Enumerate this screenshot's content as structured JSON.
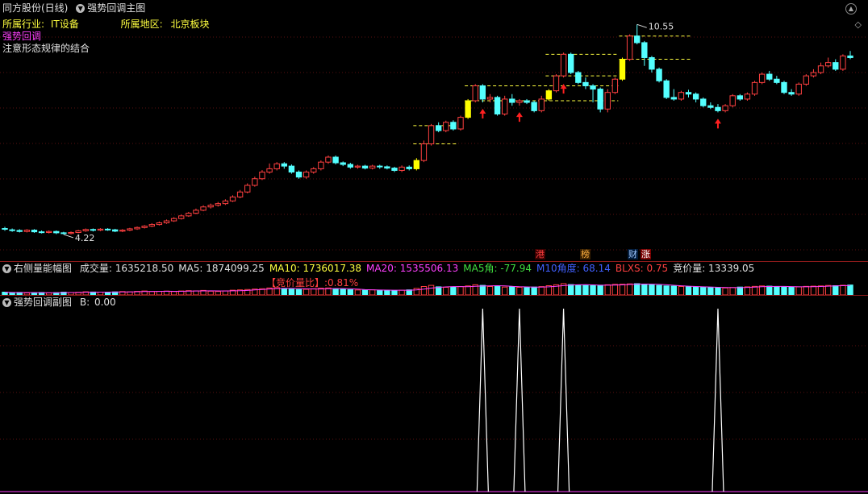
{
  "main": {
    "title": "同方股份(日线)",
    "indicator": "强势回调主图",
    "industry_label": "所属行业:",
    "industry_value": "IT设备",
    "region_label": "所属地区:",
    "region_value": "北京板块",
    "signal_name": "强势回调",
    "note": "注意形态规律的结合",
    "high_label": "10.55",
    "low_label": "4.22",
    "tags": [
      "港",
      "榜",
      "财",
      "涨"
    ]
  },
  "volume_panel": {
    "title": "右侧量能幅图",
    "items": [
      {
        "label": "成交量:",
        "value": "1635218.50",
        "color": "#e0e0e0"
      },
      {
        "label": "MA5:",
        "value": "1874099.25",
        "color": "#e0e0e0"
      },
      {
        "label": "MA10:",
        "value": "1736017.38",
        "color": "#ffff40"
      },
      {
        "label": "MA20:",
        "value": "1535506.13",
        "color": "#ff40ff"
      },
      {
        "label": "MA5角:",
        "value": "-77.94",
        "color": "#40e040"
      },
      {
        "label": "M10角度:",
        "value": "68.14",
        "color": "#4060ff"
      },
      {
        "label": "BLXS:",
        "value": "0.75",
        "color": "#ff4040"
      },
      {
        "label": "竞价量:",
        "value": "13339.05",
        "color": "#e0e0e0"
      }
    ],
    "bid_ratio_label": "【竞价量比】:0.81%"
  },
  "sub_panel": {
    "title": "强势回调副图",
    "b_label": "B:",
    "b_value": "0.00"
  },
  "chart_data": {
    "type": "candlestick",
    "ylim": [
      4.0,
      10.8
    ],
    "annotations": {
      "max": 10.55,
      "min": 4.22
    },
    "candles": [
      [
        4.4,
        4.38,
        4.45,
        4.33
      ],
      [
        4.36,
        4.34,
        4.4,
        4.3
      ],
      [
        4.34,
        4.31,
        4.38,
        4.28
      ],
      [
        4.31,
        4.35,
        4.38,
        4.28
      ],
      [
        4.35,
        4.3,
        4.38,
        4.27
      ],
      [
        4.3,
        4.28,
        4.34,
        4.25
      ],
      [
        4.28,
        4.31,
        4.34,
        4.25
      ],
      [
        4.31,
        4.27,
        4.34,
        4.23
      ],
      [
        4.27,
        4.25,
        4.3,
        4.22
      ],
      [
        4.25,
        4.28,
        4.31,
        4.22
      ],
      [
        4.28,
        4.33,
        4.36,
        4.26
      ],
      [
        4.33,
        4.37,
        4.4,
        4.3
      ],
      [
        4.37,
        4.35,
        4.4,
        4.31
      ],
      [
        4.35,
        4.38,
        4.41,
        4.32
      ],
      [
        4.38,
        4.36,
        4.41,
        4.33
      ],
      [
        4.36,
        4.32,
        4.39,
        4.29
      ],
      [
        4.32,
        4.35,
        4.38,
        4.29
      ],
      [
        4.35,
        4.39,
        4.42,
        4.32
      ],
      [
        4.39,
        4.43,
        4.46,
        4.36
      ],
      [
        4.43,
        4.47,
        4.5,
        4.4
      ],
      [
        4.47,
        4.52,
        4.56,
        4.44
      ],
      [
        4.52,
        4.57,
        4.61,
        4.49
      ],
      [
        4.57,
        4.63,
        4.67,
        4.54
      ],
      [
        4.63,
        4.7,
        4.74,
        4.6
      ],
      [
        4.7,
        4.78,
        4.82,
        4.67
      ],
      [
        4.78,
        4.86,
        4.9,
        4.75
      ],
      [
        4.86,
        4.95,
        5.0,
        4.83
      ],
      [
        4.95,
        5.05,
        5.1,
        4.92
      ],
      [
        5.05,
        5.1,
        5.15,
        5.0
      ],
      [
        5.1,
        5.15,
        5.2,
        5.06
      ],
      [
        5.15,
        5.23,
        5.28,
        5.11
      ],
      [
        5.23,
        5.35,
        5.4,
        5.2
      ],
      [
        5.35,
        5.5,
        5.56,
        5.31
      ],
      [
        5.5,
        5.7,
        5.76,
        5.46
      ],
      [
        5.7,
        5.9,
        5.96,
        5.66
      ],
      [
        5.9,
        6.1,
        6.16,
        5.86
      ],
      [
        6.1,
        6.2,
        6.36,
        6.05
      ],
      [
        6.2,
        6.35,
        6.4,
        6.15
      ],
      [
        6.35,
        6.28,
        6.4,
        6.2
      ],
      [
        6.28,
        6.1,
        6.33,
        6.05
      ],
      [
        6.1,
        5.95,
        6.15,
        5.9
      ],
      [
        5.95,
        6.1,
        6.15,
        5.9
      ],
      [
        6.1,
        6.2,
        6.25,
        6.05
      ],
      [
        6.2,
        6.4,
        6.45,
        6.15
      ],
      [
        6.4,
        6.55,
        6.6,
        6.35
      ],
      [
        6.55,
        6.38,
        6.6,
        6.33
      ],
      [
        6.38,
        6.33,
        6.42,
        6.28
      ],
      [
        6.33,
        6.25,
        6.38,
        6.2
      ],
      [
        6.25,
        6.28,
        6.32,
        6.2
      ],
      [
        6.28,
        6.22,
        6.32,
        6.18
      ],
      [
        6.22,
        6.28,
        6.32,
        6.18
      ],
      [
        6.28,
        6.26,
        6.32,
        6.2
      ],
      [
        6.26,
        6.22,
        6.3,
        6.18
      ],
      [
        6.22,
        6.15,
        6.26,
        6.1
      ],
      [
        6.15,
        6.25,
        6.3,
        6.1
      ],
      [
        6.25,
        6.2,
        6.3,
        6.15
      ],
      [
        6.2,
        6.45,
        6.52,
        6.15
      ],
      [
        6.45,
        6.95,
        7.05,
        6.4
      ],
      [
        6.95,
        7.5,
        7.55,
        6.9
      ],
      [
        7.5,
        7.35,
        7.6,
        7.3
      ],
      [
        7.35,
        7.6,
        7.65,
        7.3
      ],
      [
        7.6,
        7.4,
        7.66,
        7.35
      ],
      [
        7.4,
        7.75,
        7.8,
        7.35
      ],
      [
        7.75,
        8.25,
        8.3,
        7.7
      ],
      [
        8.25,
        8.7,
        8.75,
        8.2
      ],
      [
        8.7,
        8.3,
        8.75,
        8.2
      ],
      [
        8.3,
        8.35,
        8.45,
        8.2
      ],
      [
        8.35,
        7.85,
        8.4,
        7.8
      ],
      [
        7.85,
        8.3,
        8.4,
        7.8
      ],
      [
        8.3,
        8.2,
        8.45,
        8.1
      ],
      [
        8.2,
        8.25,
        8.3,
        8.1
      ],
      [
        8.25,
        8.2,
        8.3,
        8.15
      ],
      [
        8.2,
        7.95,
        8.25,
        7.9
      ],
      [
        7.95,
        8.3,
        8.4,
        7.9
      ],
      [
        8.3,
        8.55,
        8.6,
        8.25
      ],
      [
        8.55,
        9.0,
        9.05,
        8.5
      ],
      [
        9.0,
        9.65,
        9.7,
        8.95
      ],
      [
        9.65,
        9.1,
        9.7,
        9.05
      ],
      [
        9.1,
        8.8,
        9.15,
        8.75
      ],
      [
        8.8,
        8.7,
        8.95,
        8.6
      ],
      [
        8.7,
        8.6,
        8.75,
        8.2
      ],
      [
        8.6,
        8.0,
        8.65,
        7.9
      ],
      [
        8.0,
        8.5,
        8.6,
        7.9
      ],
      [
        8.5,
        8.9,
        8.95,
        8.45
      ],
      [
        8.9,
        9.5,
        9.55,
        8.85
      ],
      [
        9.5,
        10.2,
        10.25,
        9.45
      ],
      [
        10.2,
        10.0,
        10.55,
        9.95
      ],
      [
        10.0,
        9.55,
        10.05,
        9.3
      ],
      [
        9.55,
        9.2,
        9.6,
        9.1
      ],
      [
        9.2,
        8.85,
        9.25,
        8.8
      ],
      [
        8.85,
        8.35,
        8.9,
        8.3
      ],
      [
        8.35,
        8.3,
        8.6,
        8.25
      ],
      [
        8.3,
        8.5,
        8.55,
        8.25
      ],
      [
        8.5,
        8.45,
        8.58,
        8.35
      ],
      [
        8.45,
        8.3,
        8.5,
        8.2
      ],
      [
        8.3,
        8.1,
        8.35,
        8.05
      ],
      [
        8.1,
        8.05,
        8.2,
        8.0
      ],
      [
        8.05,
        7.95,
        8.15,
        7.9
      ],
      [
        7.95,
        8.1,
        8.15,
        7.9
      ],
      [
        8.1,
        8.4,
        8.45,
        8.05
      ],
      [
        8.4,
        8.3,
        8.45,
        8.25
      ],
      [
        8.3,
        8.45,
        8.5,
        8.25
      ],
      [
        8.45,
        8.8,
        8.85,
        8.4
      ],
      [
        8.8,
        9.05,
        9.1,
        8.75
      ],
      [
        9.05,
        8.9,
        9.15,
        8.85
      ],
      [
        8.9,
        8.8,
        9.0,
        8.75
      ],
      [
        8.8,
        8.5,
        8.85,
        8.45
      ],
      [
        8.5,
        8.45,
        8.6,
        8.4
      ],
      [
        8.45,
        8.75,
        8.8,
        8.4
      ],
      [
        8.75,
        9.0,
        9.05,
        8.7
      ],
      [
        9.0,
        9.1,
        9.2,
        8.95
      ],
      [
        9.1,
        9.3,
        9.4,
        9.05
      ],
      [
        9.3,
        9.4,
        9.55,
        9.25
      ],
      [
        9.4,
        9.2,
        9.5,
        9.15
      ],
      [
        9.2,
        9.6,
        9.65,
        9.15
      ],
      [
        9.6,
        9.55,
        9.75,
        9.5
      ]
    ],
    "yellow_candles": [
      56,
      63,
      74,
      84
    ],
    "resistance_lines": [
      {
        "from": 56,
        "to": 61,
        "value": 7.5
      },
      {
        "from": 56,
        "to": 61,
        "value": 6.95
      },
      {
        "from": 63,
        "to": 83,
        "value": 8.7
      },
      {
        "from": 63,
        "to": 83,
        "value": 8.25
      },
      {
        "from": 74,
        "to": 83,
        "value": 9.0
      },
      {
        "from": 74,
        "to": 83,
        "value": 9.65
      },
      {
        "from": 84,
        "to": 93,
        "value": 10.2
      },
      {
        "from": 84,
        "to": 93,
        "value": 9.5
      }
    ],
    "up_arrows": [
      65,
      70,
      76,
      97
    ],
    "sub_signals": [
      65,
      70,
      76,
      97
    ],
    "volume": [
      0.25,
      0.2,
      0.22,
      0.18,
      0.2,
      0.22,
      0.18,
      0.2,
      0.25,
      0.22,
      0.24,
      0.28,
      0.26,
      0.25,
      0.24,
      0.27,
      0.3,
      0.28,
      0.32,
      0.35,
      0.3,
      0.32,
      0.34,
      0.3,
      0.35,
      0.38,
      0.36,
      0.4,
      0.33,
      0.31,
      0.36,
      0.42,
      0.45,
      0.48,
      0.52,
      0.55,
      0.62,
      0.65,
      0.58,
      0.52,
      0.48,
      0.5,
      0.55,
      0.6,
      0.62,
      0.55,
      0.5,
      0.46,
      0.44,
      0.42,
      0.45,
      0.43,
      0.4,
      0.38,
      0.42,
      0.45,
      0.58,
      0.75,
      0.85,
      0.72,
      0.68,
      0.7,
      0.74,
      0.8,
      0.9,
      0.85,
      0.75,
      0.8,
      0.7,
      0.72,
      0.68,
      0.66,
      0.7,
      0.74,
      0.82,
      0.9,
      1.0,
      0.92,
      0.88,
      0.85,
      0.82,
      0.86,
      0.9,
      0.94,
      0.95,
      0.98,
      1.0,
      0.96,
      0.9,
      0.85,
      0.8,
      0.78,
      0.75,
      0.72,
      0.7,
      0.68,
      0.66,
      0.64,
      0.62,
      0.66,
      0.7,
      0.72,
      0.76,
      0.8,
      0.78,
      0.74,
      0.7,
      0.68,
      0.72,
      0.76,
      0.78,
      0.8,
      0.84,
      0.82,
      0.86,
      0.88
    ]
  }
}
